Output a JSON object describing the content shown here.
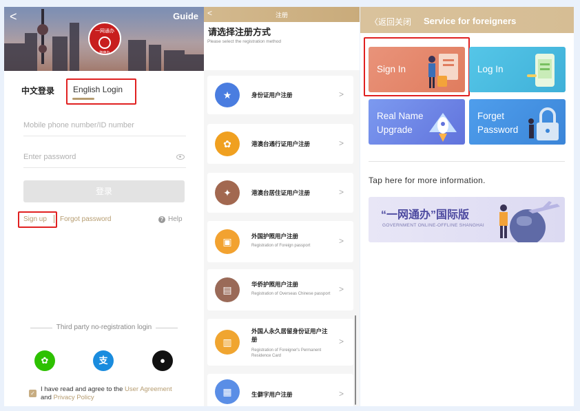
{
  "login": {
    "back": "<",
    "guide": "Guide",
    "logo_text": "一网通办",
    "logo_sub": "随申办",
    "tab_cn": "中文登录",
    "tab_en": "English Login",
    "phone_placeholder": "Mobile phone number/ID number",
    "password_placeholder": "Enter password",
    "login_button": "登录",
    "sign_up": "Sign up",
    "separator": "|",
    "forgot": "Forgot password",
    "help": "Help",
    "help_icon": "?",
    "third_party": "Third party no-registration login",
    "wechat_glyph": "✿",
    "alipay_glyph": "支",
    "apple_glyph": "●",
    "check_glyph": "✓",
    "agree_prefix": "I have read and agree to the ",
    "user_agreement": "User Agreement",
    "and": "and ",
    "privacy_policy": "Privacy Policy"
  },
  "register": {
    "back": "<",
    "header_title": "注册",
    "heading": "请选择注册方式",
    "subheading": "Please select the registration method",
    "chevron": ">",
    "items": [
      {
        "title": "身份证用户注册",
        "subtitle": "",
        "icon": "id-card-emblem-icon",
        "glyph": "★",
        "color": "#4a7de0"
      },
      {
        "title": "港澳台通行证用户注册",
        "subtitle": "",
        "icon": "bauhinia-flower-icon",
        "glyph": "✿",
        "color": "#f0a020"
      },
      {
        "title": "港澳台居住证用户注册",
        "subtitle": "",
        "icon": "residence-permit-icon",
        "glyph": "✦",
        "color": "#a26850"
      },
      {
        "title": "外国护照用户注册",
        "subtitle": "Registration of Foreign passport",
        "icon": "foreign-passport-icon",
        "glyph": "▣",
        "color": "#f2a230"
      },
      {
        "title": "华侨护照用户注册",
        "subtitle": "Registration of Overseas Chinese passport",
        "icon": "overseas-passport-icon",
        "glyph": "▤",
        "color": "#9a6a58"
      },
      {
        "title": "外国人永久居留身份证用户注册",
        "subtitle": "Registration of Foreigner's Permanent Residence Card",
        "icon": "permanent-residence-card-icon",
        "glyph": "▥",
        "color": "#f0a530"
      },
      {
        "title": "生僻字用户注册",
        "subtitle": "",
        "icon": "rare-character-icon",
        "glyph": "▦",
        "color": "#5a8ee6"
      }
    ]
  },
  "foreigners": {
    "back": "〈返回",
    "close": "关闭",
    "title": "Service for foreigners",
    "tiles": {
      "sign_in": "Sign In",
      "log_in": "Log In",
      "real_name_1": "Real Name",
      "real_name_2": "Upgrade",
      "forget_1": "Forget",
      "forget_2": "Password"
    },
    "more_info": "Tap here for more information.",
    "banner_title": "“一网通办”国际版",
    "banner_sub": "GOVERNMENT ONLINE-OFFLINE SHANGHAI"
  },
  "colors": {
    "accent_gold": "#b69c70",
    "highlight_red": "#e02020",
    "wechat": "#2dc100",
    "alipay": "#1a8cde",
    "apple": "#111111",
    "tile_sign_in": "#e58b6d",
    "tile_log_in": "#4fc1e5",
    "tile_real_name": "#6f88e6",
    "tile_forget": "#4a9ee6"
  }
}
